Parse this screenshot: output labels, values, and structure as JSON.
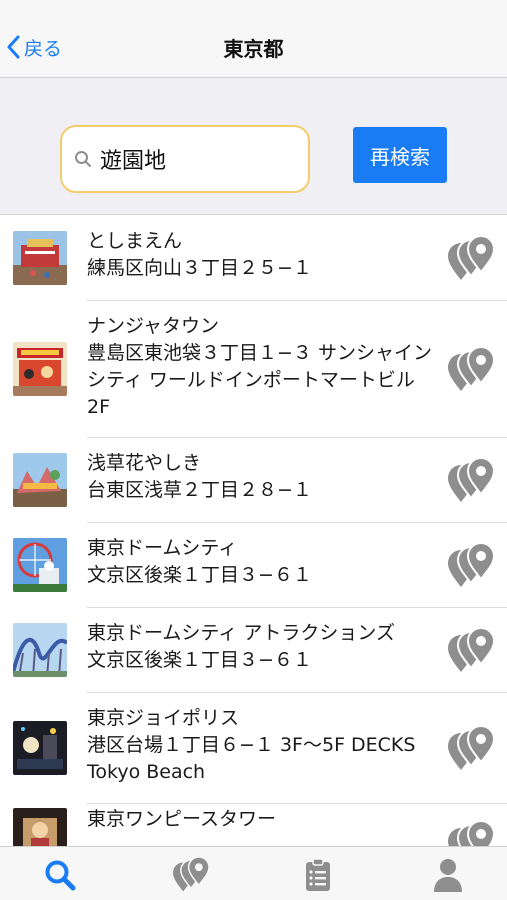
{
  "nav": {
    "back_label": "戻る",
    "title": "東京都"
  },
  "search": {
    "query": "遊園地",
    "button_label": "再検索"
  },
  "colors": {
    "accent": "#1a7cf4",
    "search_border": "#f1cd6b",
    "icon_gray": "#8e8e8e"
  },
  "results": [
    {
      "name": "としまえん",
      "address": "練馬区向山３丁目２５−１",
      "thumb": "toshimaen"
    },
    {
      "name": "ナンジャタウン",
      "address": "豊島区東池袋３丁目１−３ サンシャインシティ ワールドインポートマートビル 2F",
      "thumb": "namja"
    },
    {
      "name": "浅草花やしき",
      "address": "台東区浅草２丁目２８−１",
      "thumb": "hanayashiki"
    },
    {
      "name": "東京ドームシティ",
      "address": "文京区後楽１丁目３−６１",
      "thumb": "tokyodome"
    },
    {
      "name": "東京ドームシティ アトラクションズ",
      "address": "文京区後楽１丁目３−６１",
      "thumb": "attractions"
    },
    {
      "name": "東京ジョイポリス",
      "address": "港区台場１丁目６−１ 3F〜5F DECKS Tokyo Beach",
      "thumb": "joypolis"
    },
    {
      "name": "東京ワンピースタワー",
      "address": "",
      "thumb": "onepiece"
    }
  ],
  "tabs": [
    {
      "name": "search-tab",
      "icon": "search-icon",
      "active": true
    },
    {
      "name": "map-pins-tab",
      "icon": "map-pins-icon",
      "active": false
    },
    {
      "name": "list-tab",
      "icon": "clipboard-icon",
      "active": false
    },
    {
      "name": "profile-tab",
      "icon": "person-icon",
      "active": false
    }
  ]
}
